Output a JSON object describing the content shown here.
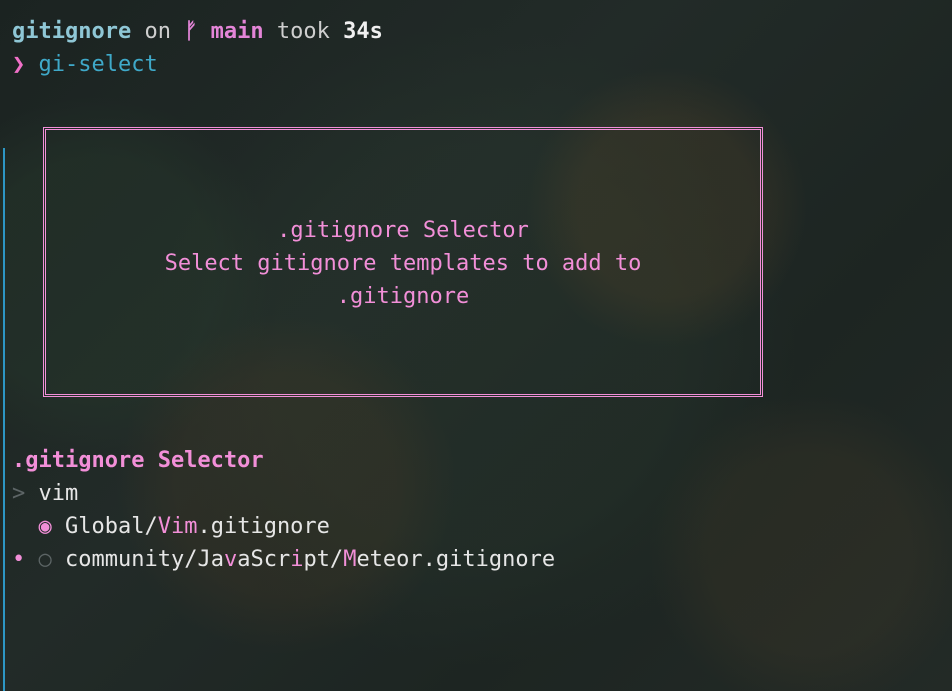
{
  "prompt": {
    "directory": "gitignore",
    "on_text": "on",
    "branch_icon": "git-branch-icon",
    "branch_glyph": "ᚠ",
    "branch": "main",
    "took_text": "took",
    "duration": "34s"
  },
  "command": {
    "arrow": "❯",
    "text": "gi-select"
  },
  "header_box": {
    "title": ".gitignore Selector",
    "subtitle_line1": "Select gitignore templates to add to",
    "subtitle_line2": ".gitignore"
  },
  "selector": {
    "title": ".gitignore Selector",
    "filter_caret": ">",
    "filter_value": "vim",
    "items": [
      {
        "cursor": "",
        "radio": "◉",
        "selected": true,
        "prefix": "Global/",
        "match": "Vim",
        "suffix": ".gitignore"
      },
      {
        "cursor": "•",
        "radio": "○",
        "selected": false,
        "seg1": "community/Ja",
        "m1": "v",
        "seg2": "aScr",
        "m2": "i",
        "seg3": "pt/",
        "m3": "M",
        "seg4": "eteor.gitignore"
      }
    ]
  },
  "colors": {
    "accent_pink": "#f28fd8",
    "branch_purple": "#e485d8",
    "command_blue": "#3fa9c9",
    "dir_blue": "#8fc7d6",
    "gutter_blue": "#2d96c4"
  }
}
